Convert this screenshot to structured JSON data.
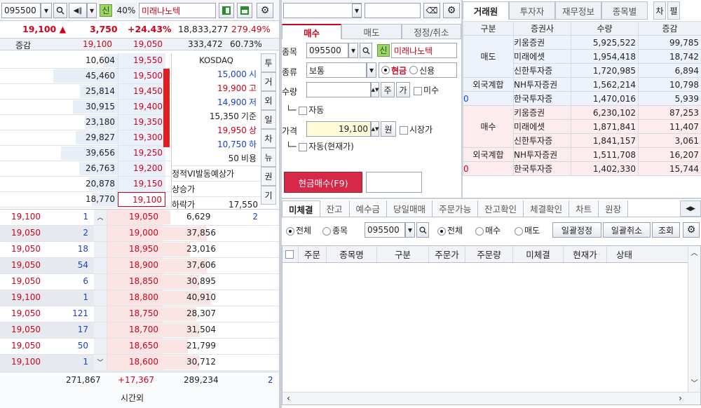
{
  "left": {
    "code": "095500",
    "name": "미래나노텍",
    "pct_badge": "40%",
    "credit_badge": "신",
    "summary": {
      "price": "19,100 ▲",
      "change": "3,750",
      "rate": "+24.43%",
      "volume": "18,833,277",
      "turnover": "279.49%"
    },
    "header": {
      "label": "증감",
      "p1": "19,100",
      "p2": "19,050",
      "vol": "333,472",
      "ratio": "60.73%"
    },
    "asks": [
      {
        "qty": "10,604",
        "price": "19,550",
        "w": 0.12
      },
      {
        "qty": "45,460",
        "price": "19,500",
        "w": 0.55
      },
      {
        "qty": "25,814",
        "price": "19,450",
        "w": 0.32
      },
      {
        "qty": "30,915",
        "price": "19,400",
        "w": 0.38
      },
      {
        "qty": "23,180",
        "price": "19,350",
        "w": 0.28
      },
      {
        "qty": "29,827",
        "price": "19,300",
        "w": 0.36
      },
      {
        "qty": "39,656",
        "price": "19,250",
        "w": 0.48
      },
      {
        "qty": "26,763",
        "price": "19,200",
        "w": 0.33
      },
      {
        "qty": "20,878",
        "price": "19,150",
        "w": 0.25
      },
      {
        "qty": "18,770",
        "price": "19,100",
        "w": 0.22
      }
    ],
    "info": {
      "market": "KOSDAQ",
      "rows": [
        {
          "v": "15,000",
          "l": "시",
          "c": "blue"
        },
        {
          "v": "19,900",
          "l": "고",
          "c": "red"
        },
        {
          "v": "14,900",
          "l": "저",
          "c": "blue"
        },
        {
          "v": "15,350",
          "l": "기준",
          "c": "dark"
        },
        {
          "v": "19,950",
          "l": "상",
          "c": "red"
        },
        {
          "v": "10,750",
          "l": "하",
          "c": "blue"
        },
        {
          "v": "50",
          "l": "비용",
          "c": "dark"
        }
      ],
      "vi": "정적VI발동예상가",
      "up": "상승가",
      "down": "하락가",
      "down_val": "17,550"
    },
    "sidetabs": [
      "투",
      "거",
      "외",
      "일",
      "차",
      "뉴",
      "권",
      "기"
    ],
    "bids": [
      {
        "tick": "19,100",
        "tq": "1",
        "price": "19,050",
        "qty": "6,629",
        "w": 0.08,
        "extra": "2"
      },
      {
        "tick": "19,050",
        "tq": "2",
        "price": "19,000",
        "qty": "37,856",
        "w": 0.45,
        "extra": ""
      },
      {
        "tick": "19,050",
        "tq": "18",
        "price": "18,950",
        "qty": "23,016",
        "w": 0.28,
        "extra": ""
      },
      {
        "tick": "19,050",
        "tq": "54",
        "price": "18,900",
        "qty": "37,606",
        "w": 0.45,
        "extra": ""
      },
      {
        "tick": "19,050",
        "tq": "6",
        "price": "18,850",
        "qty": "30,895",
        "w": 0.37,
        "extra": ""
      },
      {
        "tick": "19,100",
        "tq": "1",
        "price": "18,800",
        "qty": "40,910",
        "w": 0.49,
        "extra": ""
      },
      {
        "tick": "19,050",
        "tq": "121",
        "price": "18,750",
        "qty": "28,307",
        "w": 0.34,
        "extra": ""
      },
      {
        "tick": "19,050",
        "tq": "17",
        "price": "18,700",
        "qty": "31,504",
        "w": 0.38,
        "extra": ""
      },
      {
        "tick": "19,050",
        "tq": "50",
        "price": "18,650",
        "qty": "21,799",
        "w": 0.26,
        "extra": ""
      },
      {
        "tick": "19,100",
        "tq": "1",
        "price": "18,600",
        "qty": "30,712",
        "w": 0.37,
        "extra": ""
      }
    ],
    "footer": {
      "ask_total": "271,867",
      "diff": "+17,367",
      "bid_total": "289,234",
      "extra": "2",
      "after_hours": "시간외"
    }
  },
  "order": {
    "tabs": [
      "매수",
      "매도",
      "정정/취소"
    ],
    "lbl_code": "종목",
    "code": "095500",
    "credit": "신",
    "name": "미래나노텍",
    "lbl_kind": "종류",
    "kind": "보통",
    "cash": "현금",
    "credit_opt": "신용",
    "lbl_qty": "수량",
    "ju": "주",
    "ga": "가",
    "misu": "미수",
    "auto": "자동",
    "lbl_price": "가격",
    "price": "19,100",
    "won": "원",
    "market": "시장가",
    "auto_price": "자동(현재가)",
    "buy_btn": "현금매수(F9)"
  },
  "broker": {
    "tabs": [
      "거래원",
      "투자자",
      "재무정보",
      "종목별"
    ],
    "extra_tabs": [
      "차",
      "펼"
    ],
    "headers": [
      "구분",
      "증권사",
      "수량",
      "증감"
    ],
    "sell_label": "매도",
    "buy_label": "매수",
    "foreign_label": "외국계합",
    "foreign_val": "0",
    "sell": [
      {
        "n": "키움증권",
        "q": "5,925,522",
        "d": "99,785"
      },
      {
        "n": "미래에셋",
        "q": "1,954,418",
        "d": "18,742"
      },
      {
        "n": "신한투자증",
        "q": "1,720,985",
        "d": "6,894"
      },
      {
        "n": "NH투자증권",
        "q": "1,562,214",
        "d": "10,798"
      },
      {
        "n": "한국투자증",
        "q": "1,470,016",
        "d": "5,939"
      }
    ],
    "buy": [
      {
        "n": "키움증권",
        "q": "6,230,102",
        "d": "87,253"
      },
      {
        "n": "미래에셋",
        "q": "1,871,841",
        "d": "11,407"
      },
      {
        "n": "신한투자증",
        "q": "1,841,157",
        "d": "3,061"
      },
      {
        "n": "NH투자증권",
        "q": "1,511,708",
        "d": "16,207"
      },
      {
        "n": "한국투자증",
        "q": "1,402,330",
        "d": "15,744"
      }
    ]
  },
  "unfilled": {
    "tabs": [
      "미체결",
      "잔고",
      "예수금",
      "당일매매",
      "주문가능",
      "잔고확인",
      "체결확인",
      "차트",
      "원장"
    ],
    "all": "전체",
    "stock": "종목",
    "code": "095500",
    "all2": "전체",
    "buy": "매수",
    "sell": "매도",
    "bulk_edit": "일괄정정",
    "bulk_cancel": "일괄취소",
    "query": "조회",
    "headers": [
      "주문",
      "종목명",
      "구분",
      "주문가",
      "주문량",
      "미체결",
      "현재가",
      "상태"
    ]
  },
  "colors": {
    "red": "#d0021b",
    "blue": "#1a3fd6",
    "ask_bg": "#e8eef8",
    "bid_bg": "#fbe4e4",
    "tab_red": "#d0021b"
  }
}
